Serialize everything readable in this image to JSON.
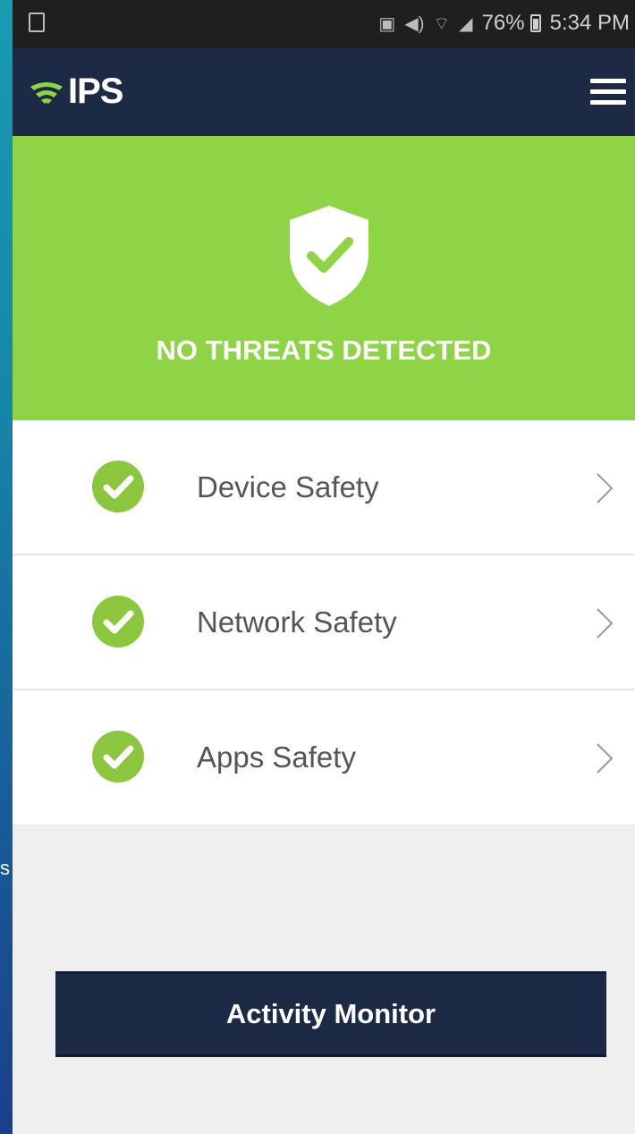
{
  "status_bar": {
    "battery": "76%",
    "time": "5:34 PM",
    "icons": [
      "nfc-icon",
      "volume-icon",
      "wifi-icon",
      "signal-icon",
      "battery-icon"
    ]
  },
  "app_bar": {
    "logo_text": "IPS",
    "menu_icon": "hamburger-menu-icon"
  },
  "hero": {
    "title": "NO THREATS DETECTED",
    "icon": "shield-check-icon"
  },
  "safety_items": [
    {
      "label": "Device Safety",
      "status_icon": "check-circle-icon"
    },
    {
      "label": "Network Safety",
      "status_icon": "check-circle-icon"
    },
    {
      "label": "Apps Safety",
      "status_icon": "check-circle-icon"
    }
  ],
  "activity_button": {
    "label": "Activity Monitor"
  },
  "colors": {
    "accent_green": "#8fd447",
    "navy": "#1c2a45",
    "check_green": "#8cc63f"
  }
}
